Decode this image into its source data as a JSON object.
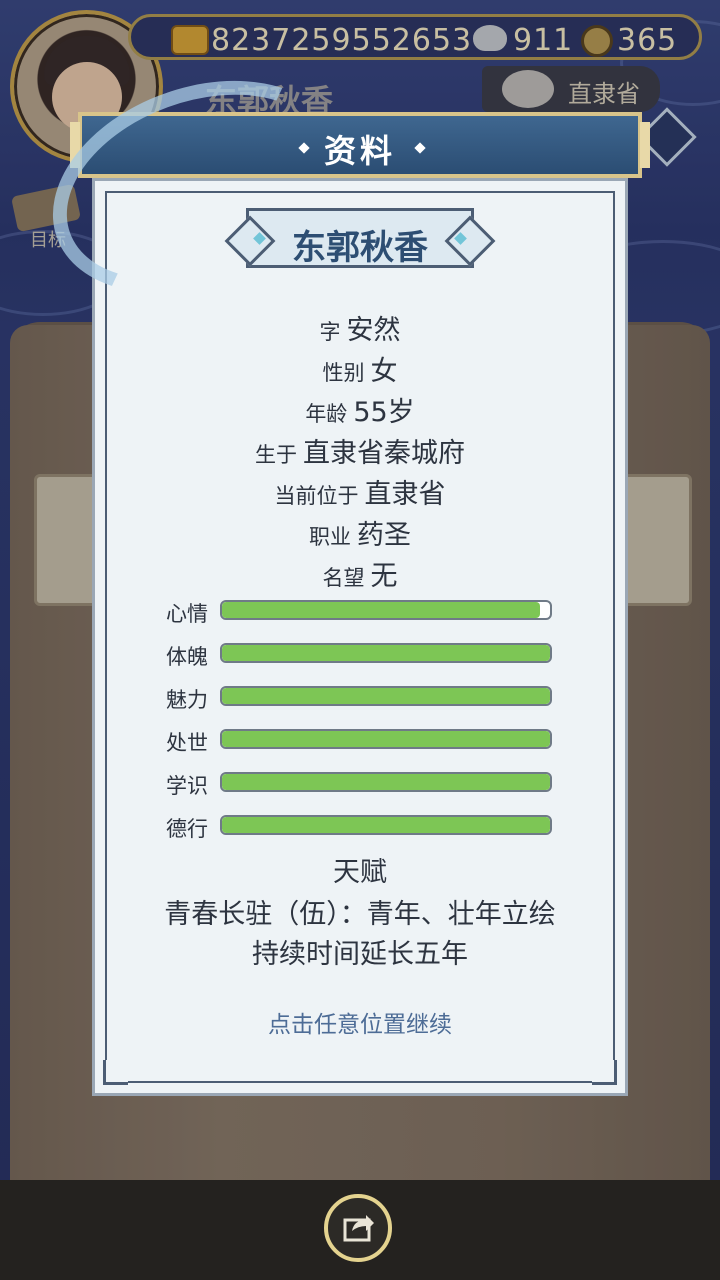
{
  "hud": {
    "gold": "8237259552653",
    "silver": "911",
    "coin": "365",
    "player_name": "东郭秋香",
    "region": "直隶省",
    "target_label": "目标"
  },
  "modal": {
    "title": "资料",
    "character_name": "东郭秋香",
    "info": [
      {
        "key": "字",
        "value": "安然"
      },
      {
        "key": "性别",
        "value": "女"
      },
      {
        "key": "年龄",
        "value": "55岁"
      },
      {
        "key": "生于",
        "value": "直隶省秦城府"
      },
      {
        "key": "当前位于",
        "value": "直隶省"
      },
      {
        "key": "职业",
        "value": "药圣"
      },
      {
        "key": "名望",
        "value": "无"
      }
    ],
    "stats": [
      {
        "label": "心情",
        "fill": 0.97
      },
      {
        "label": "体魄",
        "fill": 1.0
      },
      {
        "label": "魅力",
        "fill": 1.0
      },
      {
        "label": "处世",
        "fill": 1.0
      },
      {
        "label": "学识",
        "fill": 1.0
      },
      {
        "label": "德行",
        "fill": 1.0
      }
    ],
    "talent_title": "天赋",
    "talent_lines": [
      "青春长驻（伍）：青年、壮年立绘",
      "持续时间延长五年"
    ],
    "continue_hint": "点击任意位置继续"
  },
  "colors": {
    "bar_fill": "#7dc655",
    "title_bar": "#2b4d73",
    "hint_text": "#4d6c96"
  },
  "icons": [
    "gold-ingot-icon",
    "silver-ingot-icon",
    "copper-coin-icon",
    "region-icon",
    "share-icon"
  ]
}
